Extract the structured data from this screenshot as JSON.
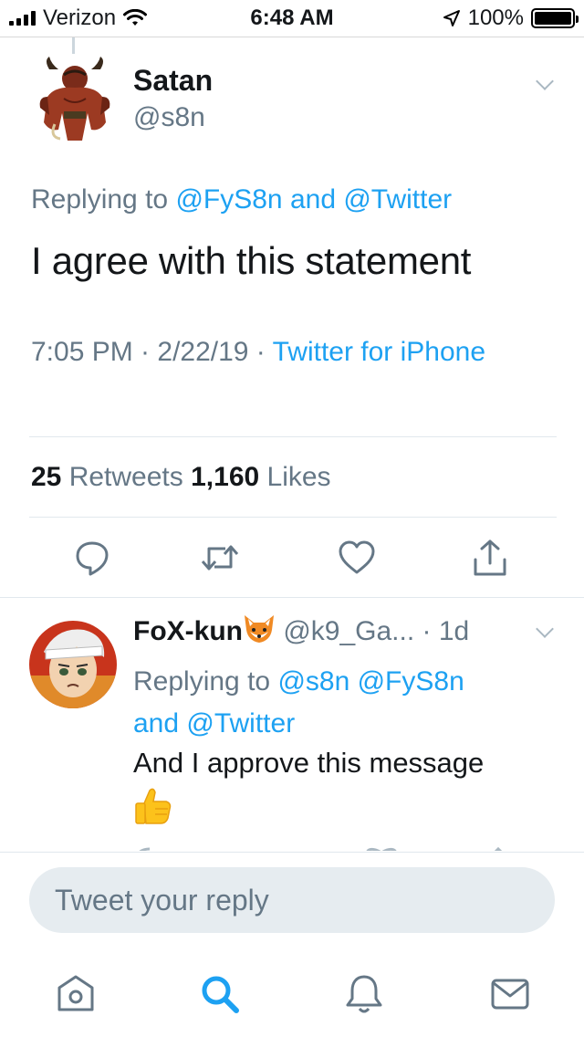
{
  "status_bar": {
    "carrier": "Verizon",
    "time": "6:48 AM",
    "battery": "100%"
  },
  "main_tweet": {
    "display_name": "Satan",
    "handle": "@s8n",
    "replying_prefix": "Replying to ",
    "replying_to_1": "@FyS8n",
    "replying_and": " and ",
    "replying_to_2": "@Twitter",
    "text": "I agree with this statement",
    "time_date": "7:05 PM · 2/22/19 · ",
    "source": "Twitter for iPhone",
    "retweet_count": "25",
    "retweet_label": " Retweets ",
    "like_count": "1,160",
    "like_label": " Likes"
  },
  "reply_tweet": {
    "display_name": "FoX-kun",
    "name_emoji": "fox-face",
    "handle": " @k9_Ga...",
    "age": " · 1d",
    "replying_prefix": "Replying to ",
    "replying_to_1": "@s8n",
    "replying_to_2": " @FyS8n",
    "replying_and": " and ",
    "replying_to_3": "@Twitter",
    "text": "And I approve this message",
    "text_emoji": "thumbs-up"
  },
  "compose": {
    "placeholder": "Tweet your reply"
  },
  "tab_bar": {
    "tabs": [
      "home-icon",
      "search-icon",
      "notifications-icon",
      "messages-icon"
    ],
    "active": "search-icon"
  },
  "colors": {
    "link": "#1da1f2",
    "muted": "#657786",
    "text": "#14171a",
    "compose_bg": "#e6ecf0"
  }
}
